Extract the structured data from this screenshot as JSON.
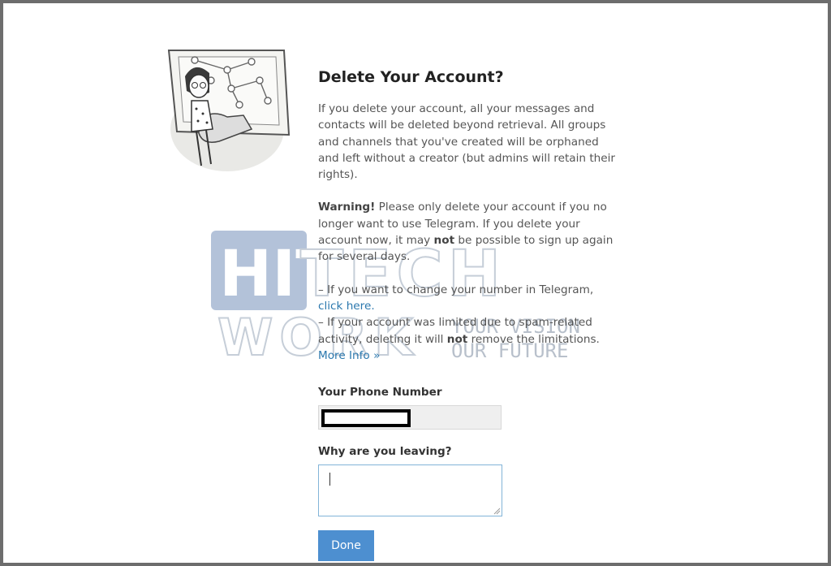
{
  "title": "Delete Your Account?",
  "intro": "If you delete your account, all your messages and contacts will be deleted beyond retrieval. All groups and channels that you've created will be orphaned and left without a creator (but admins will retain their rights).",
  "warning": {
    "label": "Warning!",
    "text_1": " Please only delete your account if you no longer want to use Telegram. If you delete your account now, it may ",
    "not": "not",
    "text_2": " be possible to sign up again for several days."
  },
  "change_number": {
    "text": "– If you want to change your number in Telegram,",
    "link": "click here."
  },
  "spam": {
    "text_1": "– If your account was limited due to spam-related activity, deleting it will ",
    "not": "not",
    "text_2": " remove the limitations.",
    "link": "More Info »"
  },
  "form": {
    "phone_label": "Your Phone Number",
    "reason_label": "Why are you leaving?",
    "done_label": "Done"
  },
  "watermark": {
    "line1": "HITECH",
    "line2": "WORK",
    "tagline1": "YOUR VISION",
    "tagline2": "OUR FUTURE"
  }
}
